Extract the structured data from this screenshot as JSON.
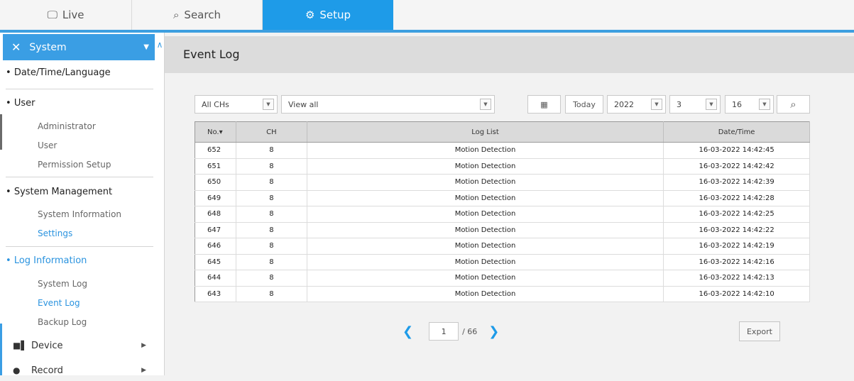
{
  "tabs": [
    {
      "label": "Live",
      "icon": "monitor-icon"
    },
    {
      "label": "Search",
      "icon": "search-icon"
    },
    {
      "label": "Setup",
      "icon": "gear-icon"
    }
  ],
  "sidebar": {
    "header": "System",
    "sections": [
      {
        "label": "Date/Time/Language",
        "items": []
      },
      {
        "label": "User",
        "items": [
          "Administrator",
          "User",
          "Permission Setup"
        ]
      },
      {
        "label": "System Management",
        "items": [
          "System Information",
          "Settings"
        ]
      },
      {
        "label": "Log Information",
        "items": [
          "System Log",
          "Event Log",
          "Backup Log"
        ]
      }
    ],
    "categories": [
      {
        "label": "Device",
        "icon": "device-icon"
      },
      {
        "label": "Record",
        "icon": "record-icon"
      }
    ]
  },
  "main": {
    "title": "Event Log",
    "filters": {
      "channel": "All CHs",
      "view": "View all",
      "today": "Today",
      "year": "2022",
      "month": "3",
      "day": "16"
    },
    "table": {
      "headers": [
        "No.▾",
        "CH",
        "Log List",
        "Date/Time"
      ],
      "rows": [
        [
          "652",
          "8",
          "Motion Detection",
          "16-03-2022 14:42:45"
        ],
        [
          "651",
          "8",
          "Motion Detection",
          "16-03-2022 14:42:42"
        ],
        [
          "650",
          "8",
          "Motion Detection",
          "16-03-2022 14:42:39"
        ],
        [
          "649",
          "8",
          "Motion Detection",
          "16-03-2022 14:42:28"
        ],
        [
          "648",
          "8",
          "Motion Detection",
          "16-03-2022 14:42:25"
        ],
        [
          "647",
          "8",
          "Motion Detection",
          "16-03-2022 14:42:22"
        ],
        [
          "646",
          "8",
          "Motion Detection",
          "16-03-2022 14:42:19"
        ],
        [
          "645",
          "8",
          "Motion Detection",
          "16-03-2022 14:42:16"
        ],
        [
          "644",
          "8",
          "Motion Detection",
          "16-03-2022 14:42:13"
        ],
        [
          "643",
          "8",
          "Motion Detection",
          "16-03-2022 14:42:10"
        ]
      ]
    },
    "pager": {
      "current": "1",
      "total": "/ 66"
    },
    "export": "Export"
  },
  "colors": {
    "accent": "#1e9be8",
    "active_text": "#2a93df"
  }
}
